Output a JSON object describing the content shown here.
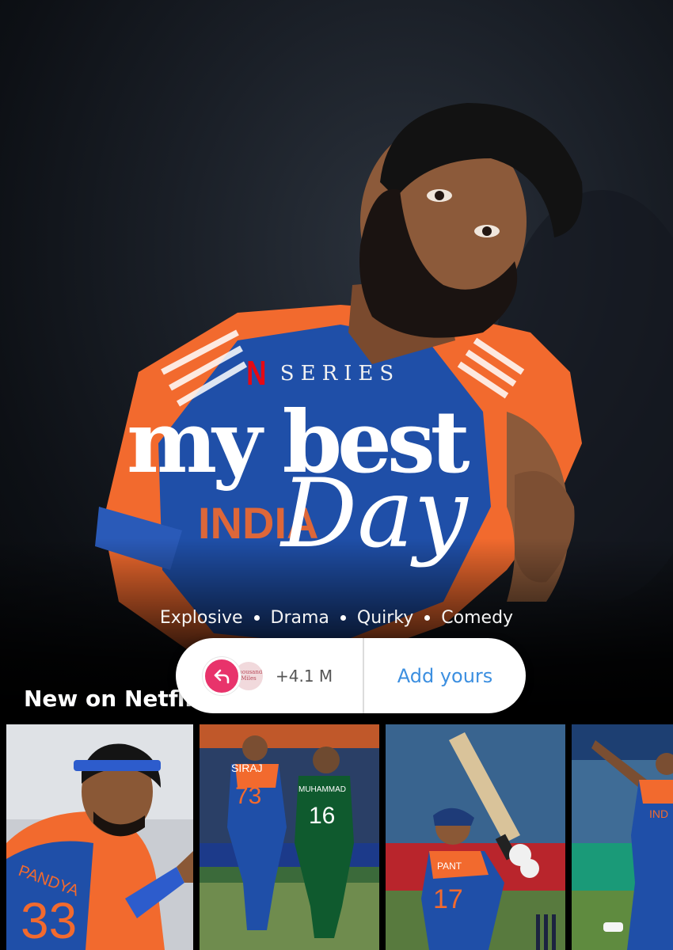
{
  "hero": {
    "series_logo": "N",
    "series_label": "SERIES",
    "title_line1": "my best",
    "title_line2": "Day",
    "genres": [
      "Explosive",
      "Drama",
      "Quirky",
      "Comedy"
    ]
  },
  "sticker": {
    "count": "+4.1 M",
    "action": "Add yours",
    "avatar_text": "Thousand Miles"
  },
  "row": {
    "title": "New on Netflix",
    "items": [
      {
        "jersey_name": "PANDYA",
        "jersey_number": "33"
      },
      {
        "jersey_name": "SIRAJ",
        "jersey_number": "73",
        "opponent_name": "MUHAMMAD",
        "opponent_number": "16"
      },
      {
        "jersey_name": "PANT",
        "jersey_number": "17"
      },
      {
        "jersey_name": "IND",
        "jersey_number": ""
      }
    ]
  },
  "colors": {
    "netflix_red": "#e50914",
    "jersey_blue": "#1f4fa8",
    "jersey_orange": "#f26a2e",
    "reply_pink": "#e8336b",
    "link_blue": "#3c8fe0"
  }
}
